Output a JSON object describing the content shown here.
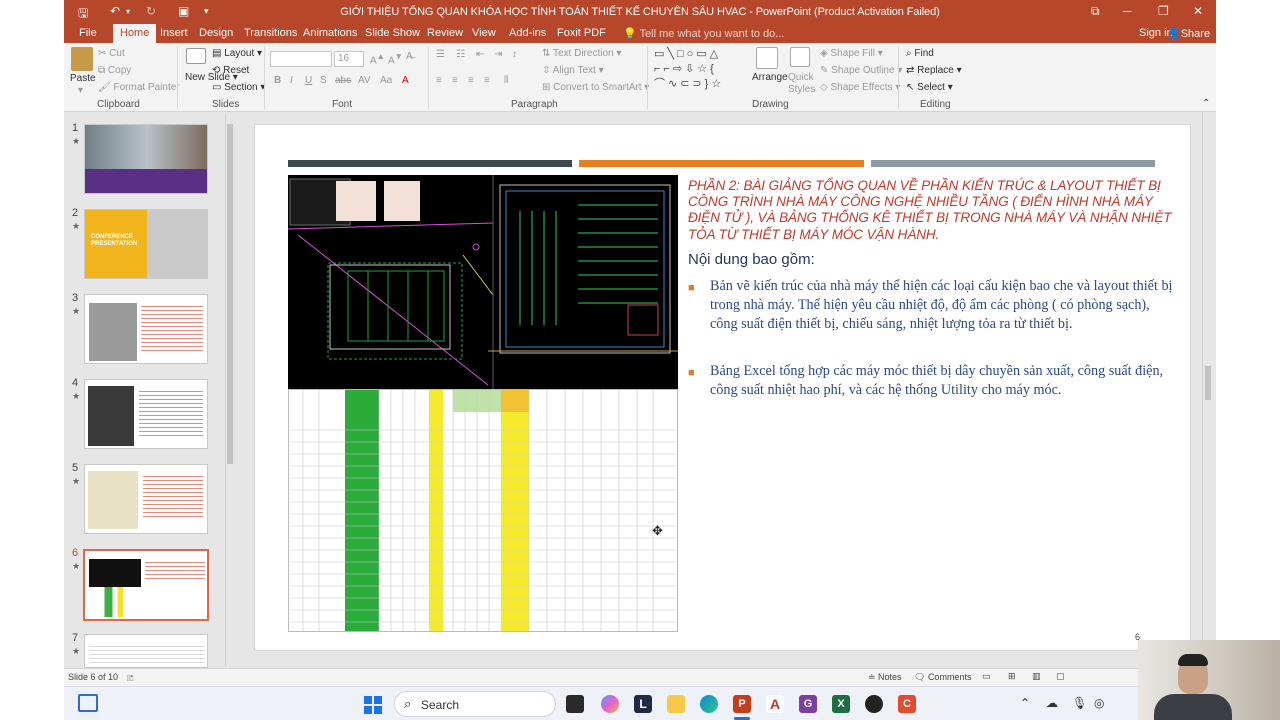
{
  "window": {
    "title": "GIỚI THIỆU TỔNG QUAN KHÓA HỌC TÍNH TOÁN THIẾT KẾ CHUYÊN SÂU HVAC  -  PowerPoint (Product Activation Failed)"
  },
  "tabs": [
    "File",
    "Home",
    "Insert",
    "Design",
    "Transitions",
    "Animations",
    "Slide Show",
    "Review",
    "View",
    "Add-ins",
    "Foxit PDF"
  ],
  "tell_me": "Tell me what you want to do...",
  "account": {
    "sign_in": "Sign in",
    "share": "Share"
  },
  "ribbon": {
    "clipboard": {
      "label": "Clipboard",
      "paste": "Paste",
      "cut": "Cut",
      "copy": "Copy",
      "format_painter": "Format Painter"
    },
    "slides": {
      "label": "Slides",
      "new_slide": "New Slide",
      "layout": "Layout",
      "reset": "Reset",
      "section": "Section"
    },
    "font": {
      "label": "Font",
      "size": "16"
    },
    "paragraph": {
      "label": "Paragraph",
      "text_direction": "Text Direction",
      "align_text": "Align Text",
      "convert": "Convert to SmartArt"
    },
    "drawing": {
      "label": "Drawing",
      "arrange": "Arrange",
      "quick_styles": "Quick Styles",
      "shape_fill": "Shape Fill",
      "shape_outline": "Shape Outline",
      "shape_effects": "Shape Effects"
    },
    "editing": {
      "label": "Editing",
      "find": "Find",
      "replace": "Replace",
      "select": "Select"
    }
  },
  "thumbnails": [
    {
      "num": "1",
      "star": "★"
    },
    {
      "num": "2",
      "star": "★"
    },
    {
      "num": "3",
      "star": "★"
    },
    {
      "num": "4",
      "star": "★"
    },
    {
      "num": "5",
      "star": "★"
    },
    {
      "num": "6",
      "star": "★"
    },
    {
      "num": "7",
      "star": "★"
    }
  ],
  "thumb_text": {
    "t2_title": "CONFERENCE PRESENTATION"
  },
  "slide": {
    "heading": "PHẦN 2: BÀI GIẢNG TỔNG QUAN VỀ PHẦN KIẾN TRÚC & LAYOUT THIẾT BỊ CÔNG TRÌNH NHÀ MÁY CÔNG NGHỆ NHIỀU TẦNG ( ĐIỂN HÌNH NHÀ MÁY ĐIỆN TỬ ), VÀ BẢNG THỐNG KÊ THIẾT BỊ TRONG NHÀ MÁY VÀ NHẬN NHIỆT TỎA TỪ THIẾT BỊ MÁY MÓC VẬN HÀNH.",
    "subheading": "Nội dung bao gồm:",
    "bullets": [
      "Bản vẽ kiến trúc của nhà máy thể hiện các loại cấu kiện bao che và layout thiết bị trong nhà máy. Thể hiện yêu cầu nhiệt độ, độ ẩm các phòng ( có phòng sạch), công suất điện thiết bị, chiếu sáng, nhiệt lượng tỏa ra từ thiết bị.",
      "Bảng Excel tổng hợp các máy móc thiết bị dây chuyền sản xuất, công suất điện, công suất nhiệt hao phí, và các hệ thống Utility cho máy móc."
    ],
    "page_number": "6",
    "bar_colors": [
      "#3d4a4f",
      "#e67e22",
      "#8e9aa3"
    ]
  },
  "status": {
    "slide_of": "Slide 6 of 10",
    "notes": "Notes",
    "comments": "Comments"
  },
  "taskbar": {
    "search": "Search"
  },
  "colors": {
    "accent": "#b7472a",
    "heading": "#c0392b",
    "body": "#2b4a88"
  }
}
